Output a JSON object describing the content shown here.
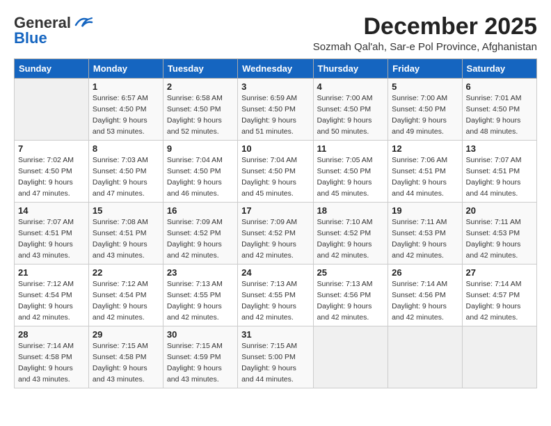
{
  "header": {
    "logo_general": "General",
    "logo_blue": "Blue",
    "month_title": "December 2025",
    "subtitle": "Sozmah Qal'ah, Sar-e Pol Province, Afghanistan"
  },
  "days_of_week": [
    "Sunday",
    "Monday",
    "Tuesday",
    "Wednesday",
    "Thursday",
    "Friday",
    "Saturday"
  ],
  "weeks": [
    [
      {
        "day": "",
        "info": ""
      },
      {
        "day": "1",
        "info": "Sunrise: 6:57 AM\nSunset: 4:50 PM\nDaylight: 9 hours\nand 53 minutes."
      },
      {
        "day": "2",
        "info": "Sunrise: 6:58 AM\nSunset: 4:50 PM\nDaylight: 9 hours\nand 52 minutes."
      },
      {
        "day": "3",
        "info": "Sunrise: 6:59 AM\nSunset: 4:50 PM\nDaylight: 9 hours\nand 51 minutes."
      },
      {
        "day": "4",
        "info": "Sunrise: 7:00 AM\nSunset: 4:50 PM\nDaylight: 9 hours\nand 50 minutes."
      },
      {
        "day": "5",
        "info": "Sunrise: 7:00 AM\nSunset: 4:50 PM\nDaylight: 9 hours\nand 49 minutes."
      },
      {
        "day": "6",
        "info": "Sunrise: 7:01 AM\nSunset: 4:50 PM\nDaylight: 9 hours\nand 48 minutes."
      }
    ],
    [
      {
        "day": "7",
        "info": "Sunrise: 7:02 AM\nSunset: 4:50 PM\nDaylight: 9 hours\nand 47 minutes."
      },
      {
        "day": "8",
        "info": "Sunrise: 7:03 AM\nSunset: 4:50 PM\nDaylight: 9 hours\nand 47 minutes."
      },
      {
        "day": "9",
        "info": "Sunrise: 7:04 AM\nSunset: 4:50 PM\nDaylight: 9 hours\nand 46 minutes."
      },
      {
        "day": "10",
        "info": "Sunrise: 7:04 AM\nSunset: 4:50 PM\nDaylight: 9 hours\nand 45 minutes."
      },
      {
        "day": "11",
        "info": "Sunrise: 7:05 AM\nSunset: 4:50 PM\nDaylight: 9 hours\nand 45 minutes."
      },
      {
        "day": "12",
        "info": "Sunrise: 7:06 AM\nSunset: 4:51 PM\nDaylight: 9 hours\nand 44 minutes."
      },
      {
        "day": "13",
        "info": "Sunrise: 7:07 AM\nSunset: 4:51 PM\nDaylight: 9 hours\nand 44 minutes."
      }
    ],
    [
      {
        "day": "14",
        "info": "Sunrise: 7:07 AM\nSunset: 4:51 PM\nDaylight: 9 hours\nand 43 minutes."
      },
      {
        "day": "15",
        "info": "Sunrise: 7:08 AM\nSunset: 4:51 PM\nDaylight: 9 hours\nand 43 minutes."
      },
      {
        "day": "16",
        "info": "Sunrise: 7:09 AM\nSunset: 4:52 PM\nDaylight: 9 hours\nand 42 minutes."
      },
      {
        "day": "17",
        "info": "Sunrise: 7:09 AM\nSunset: 4:52 PM\nDaylight: 9 hours\nand 42 minutes."
      },
      {
        "day": "18",
        "info": "Sunrise: 7:10 AM\nSunset: 4:52 PM\nDaylight: 9 hours\nand 42 minutes."
      },
      {
        "day": "19",
        "info": "Sunrise: 7:11 AM\nSunset: 4:53 PM\nDaylight: 9 hours\nand 42 minutes."
      },
      {
        "day": "20",
        "info": "Sunrise: 7:11 AM\nSunset: 4:53 PM\nDaylight: 9 hours\nand 42 minutes."
      }
    ],
    [
      {
        "day": "21",
        "info": "Sunrise: 7:12 AM\nSunset: 4:54 PM\nDaylight: 9 hours\nand 42 minutes."
      },
      {
        "day": "22",
        "info": "Sunrise: 7:12 AM\nSunset: 4:54 PM\nDaylight: 9 hours\nand 42 minutes."
      },
      {
        "day": "23",
        "info": "Sunrise: 7:13 AM\nSunset: 4:55 PM\nDaylight: 9 hours\nand 42 minutes."
      },
      {
        "day": "24",
        "info": "Sunrise: 7:13 AM\nSunset: 4:55 PM\nDaylight: 9 hours\nand 42 minutes."
      },
      {
        "day": "25",
        "info": "Sunrise: 7:13 AM\nSunset: 4:56 PM\nDaylight: 9 hours\nand 42 minutes."
      },
      {
        "day": "26",
        "info": "Sunrise: 7:14 AM\nSunset: 4:56 PM\nDaylight: 9 hours\nand 42 minutes."
      },
      {
        "day": "27",
        "info": "Sunrise: 7:14 AM\nSunset: 4:57 PM\nDaylight: 9 hours\nand 42 minutes."
      }
    ],
    [
      {
        "day": "28",
        "info": "Sunrise: 7:14 AM\nSunset: 4:58 PM\nDaylight: 9 hours\nand 43 minutes."
      },
      {
        "day": "29",
        "info": "Sunrise: 7:15 AM\nSunset: 4:58 PM\nDaylight: 9 hours\nand 43 minutes."
      },
      {
        "day": "30",
        "info": "Sunrise: 7:15 AM\nSunset: 4:59 PM\nDaylight: 9 hours\nand 43 minutes."
      },
      {
        "day": "31",
        "info": "Sunrise: 7:15 AM\nSunset: 5:00 PM\nDaylight: 9 hours\nand 44 minutes."
      },
      {
        "day": "",
        "info": ""
      },
      {
        "day": "",
        "info": ""
      },
      {
        "day": "",
        "info": ""
      }
    ]
  ]
}
